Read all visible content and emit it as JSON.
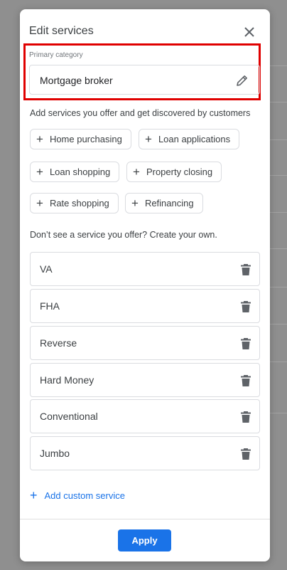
{
  "dialog": {
    "title": "Edit services",
    "close_icon": "close-icon"
  },
  "primary_category": {
    "label": "Primary category",
    "value": "Mortgage broker",
    "edit_icon": "pencil-icon",
    "highlight_color": "#e00000"
  },
  "suggestions": {
    "hint": "Add services you offer and get discovered by customers",
    "chips": [
      {
        "label": "Home purchasing"
      },
      {
        "label": "Loan applications"
      },
      {
        "label": "Loan shopping"
      },
      {
        "label": "Property closing"
      },
      {
        "label": "Rate shopping"
      },
      {
        "label": "Refinancing"
      }
    ]
  },
  "custom": {
    "prompt": "Don’t see a service you offer? Create your own.",
    "services": [
      {
        "name": "VA"
      },
      {
        "name": "FHA"
      },
      {
        "name": "Reverse"
      },
      {
        "name": "Hard Money"
      },
      {
        "name": "Conventional"
      },
      {
        "name": "Jumbo"
      }
    ],
    "delete_icon": "trash-icon",
    "add_label": "Add custom service"
  },
  "footer": {
    "apply_label": "Apply",
    "accent_color": "#1a73e8"
  }
}
